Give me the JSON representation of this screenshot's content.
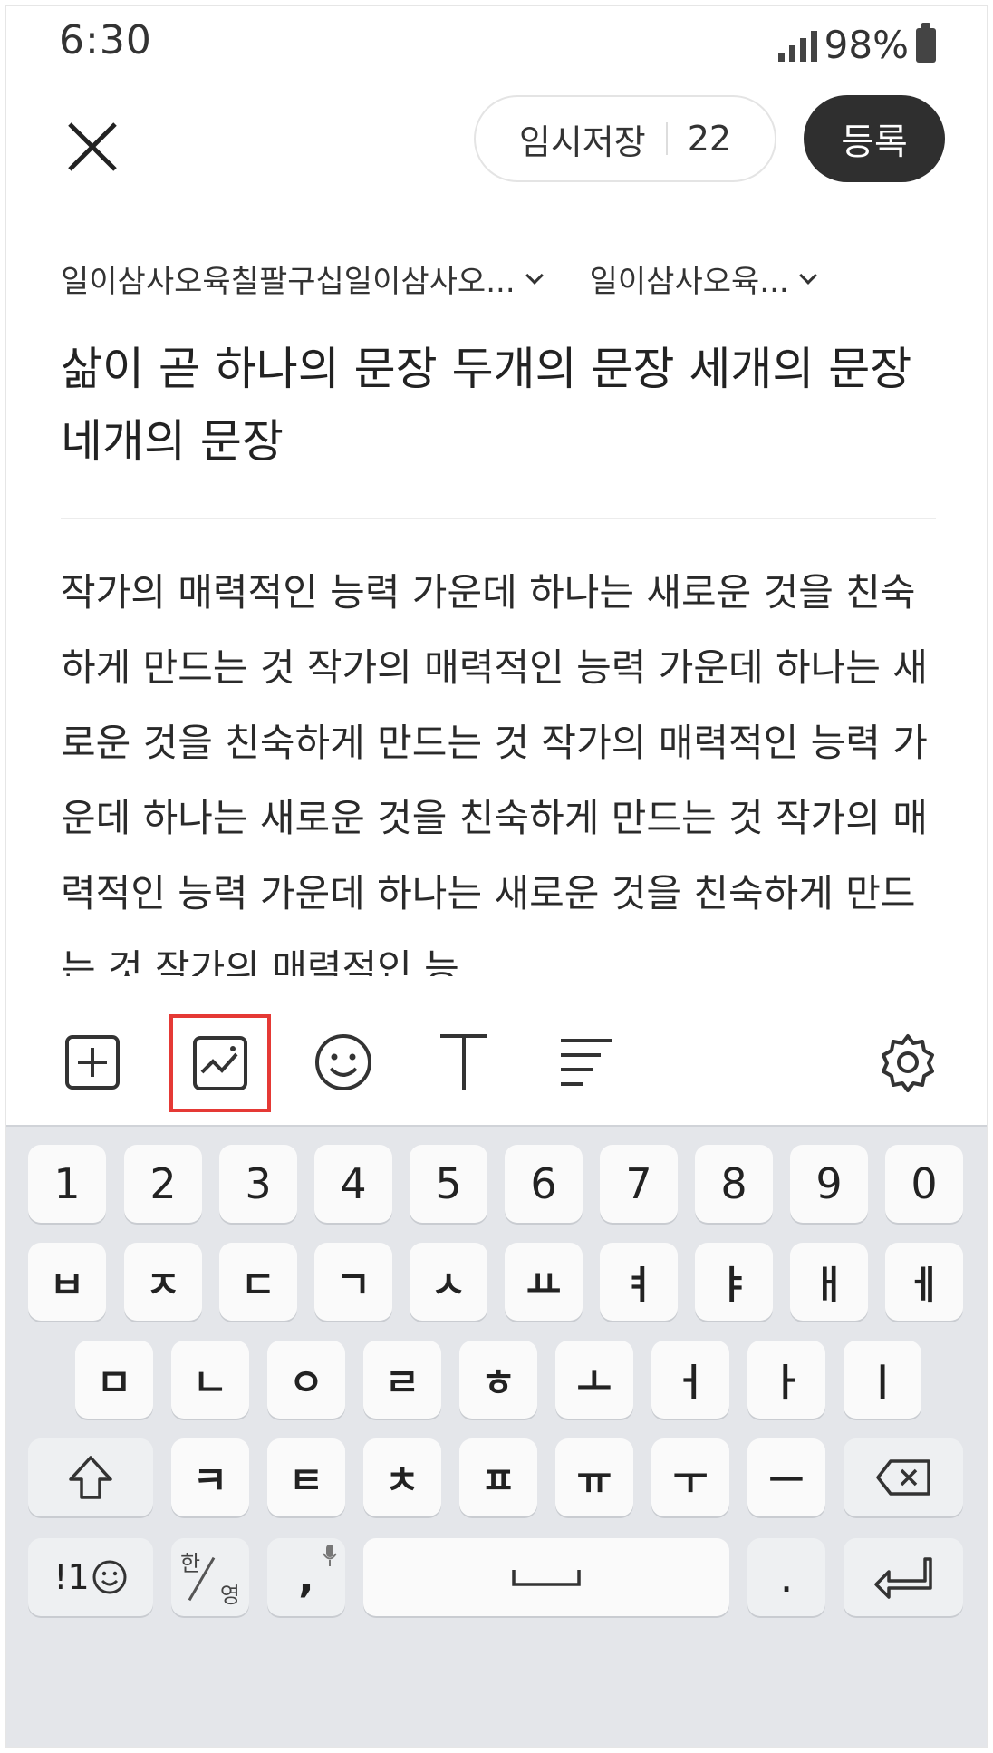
{
  "status": {
    "time": "6:30",
    "battery": "98%"
  },
  "header": {
    "temp_save_label": "임시저장",
    "temp_save_count": "22",
    "register_label": "등록"
  },
  "selectors": [
    {
      "label": "일이삼사오육칠팔구십일이삼사오..."
    },
    {
      "label": "일이삼사오육..."
    }
  ],
  "post": {
    "title": "삶이 곧 하나의 문장 두개의 문장 세개의 문장 네개의 문장",
    "body": "작가의 매력적인 능력 가운데 하나는 새로운 것을 친숙하게 만드는 것 작가의 매력적인 능력 가운데 하나는 새로운 것을 친숙하게 만드는 것 작가의 매력적인 능력 가운데 하나는 새로운 것을 친숙하게 만드는 것 작가의 매력적인 능력 가운데 하나는 새로운 것을 친숙하게 만드는 것 작가의 매력적인 능"
  },
  "toolbar": {
    "icons": [
      "add-icon",
      "image-icon",
      "emoji-icon",
      "text-format-icon",
      "align-icon",
      "settings-icon"
    ],
    "selected": "image-icon",
    "highlight_color": "#e53935"
  },
  "keyboard": {
    "row1": [
      "1",
      "2",
      "3",
      "4",
      "5",
      "6",
      "7",
      "8",
      "9",
      "0"
    ],
    "row2": [
      "ㅂ",
      "ㅈ",
      "ㄷ",
      "ㄱ",
      "ㅅ",
      "ㅛ",
      "ㅕ",
      "ㅑ",
      "ㅐ",
      "ㅔ"
    ],
    "row3": [
      "ㅁ",
      "ㄴ",
      "ㅇ",
      "ㄹ",
      "ㅎ",
      "ㅗ",
      "ㅓ",
      "ㅏ",
      "ㅣ"
    ],
    "row4": [
      "ㅋ",
      "ㅌ",
      "ㅊ",
      "ㅍ",
      "ㅠ",
      "ㅜ",
      "ㅡ"
    ],
    "symbols_label": "!1",
    "lang_top": "한",
    "lang_bottom": "영",
    "comma": ",",
    "period": "."
  },
  "colors": {
    "register_bg": "#2f2f2f",
    "keyboard_bg": "#e4e6ea"
  }
}
